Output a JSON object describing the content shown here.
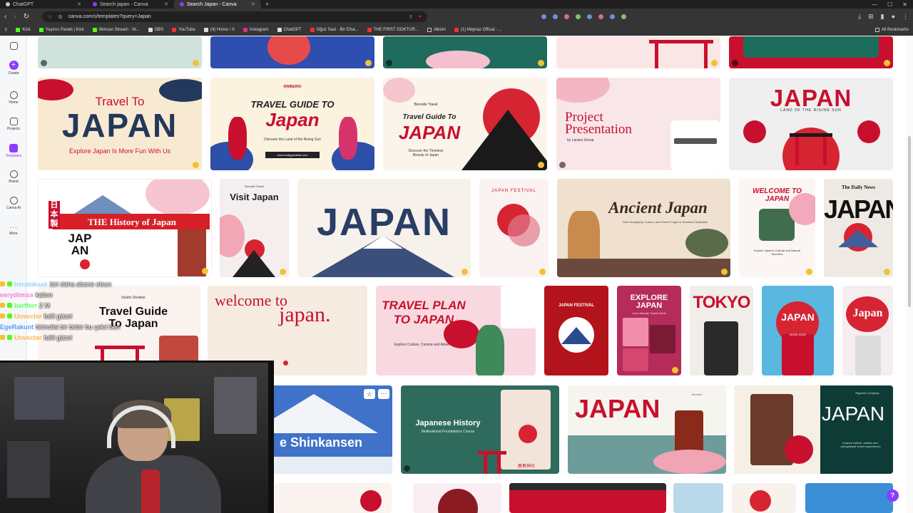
{
  "browser": {
    "tabs": [
      {
        "title": "ChatGPT",
        "active": false
      },
      {
        "title": "Search japan - Canva",
        "active": false
      },
      {
        "title": "Search Japan - Canva",
        "active": true
      }
    ],
    "url": "canva.com/s/templates?query=Japan",
    "bookmarks": [
      "Kick",
      "Yayıncı Paneli | Kick",
      "ilkinsan Stream - W...",
      "OBS",
      "YouTube",
      "(4) Home / X",
      "Instagram",
      "ChatGPT",
      "Oğuz Sasi - Bir Efsa...",
      "THE FIRST GOKTUR...",
      "Albüm",
      "(1) Mepraz Offical - ..."
    ],
    "all_bookmarks": "All Bookmarks"
  },
  "sidebar": {
    "items": [
      {
        "label": "Create",
        "icon": "plus-icon"
      },
      {
        "label": "Home",
        "icon": "home-icon"
      },
      {
        "label": "Projects",
        "icon": "folder-icon"
      },
      {
        "label": "Templates",
        "icon": "templates-icon"
      },
      {
        "label": "Brand",
        "icon": "brand-icon"
      },
      {
        "label": "Canva AI",
        "icon": "canva-ai-icon"
      },
      {
        "label": "More",
        "icon": "more-icon"
      }
    ]
  },
  "templates": {
    "travel_to_japan": {
      "line1": "Travel To",
      "line2": "JAPAN",
      "sub": "Explore Japan Is More Fun With Us"
    },
    "travel_guide_1": {
      "brand": "RIMBERIO",
      "line1": "TRAVEL GUIDE TO",
      "line2": "Japan",
      "sub": "Discover the Land of the Rising Sun",
      "url": "www.reallygreatsite.com"
    },
    "travel_guide_2": {
      "brand": "Borcelle Travel",
      "line1": "Travel Guide To",
      "line2": "JAPAN",
      "sub": "Discover the Timeless Beauty of Japan"
    },
    "project_presentation": {
      "line1": "Project",
      "line2": "Presentation",
      "sub": "by Larana Group"
    },
    "japan_red": {
      "title": "JAPAN",
      "sub": "LAND OF THE RISING SUN"
    },
    "history_of_japan": {
      "title": "THE History of Japan",
      "stamp": "日本製",
      "big": "JAPAN"
    },
    "visit_japan": {
      "brand": "Borcelle Travel",
      "title": "Visit Japan"
    },
    "japan_mountain": {
      "title": "JAPAN"
    },
    "japan_festival_1": {
      "title": "JAPAN FESTIVAL"
    },
    "ancient_japan": {
      "title": "Ancient Japan",
      "sub": "How Geography, Culture, and Power Forged a Timeless Civilization"
    },
    "welcome_to_japan_1": {
      "title": "WELCOME TO JAPAN",
      "sub": "Explore Japan's Cultural and Natural Wonders"
    },
    "daily_news": {
      "masthead": "The Daily News",
      "title": "JAPAN"
    },
    "travel_guide_3": {
      "brand": "Studio Shodwe",
      "line1": "Travel Guide",
      "line2": "To Japan"
    },
    "welcome_to_japan_2": {
      "line1": "welcome to",
      "line2": "japan."
    },
    "travel_plan": {
      "line1": "TRAVEL PLAN",
      "line2": "TO JAPAN",
      "sub": "Explore Culture, Cuisine and Adventure"
    },
    "japan_festival_2": {
      "title": "JAPAN FESTIVAL"
    },
    "explore_japan": {
      "title": "EXPLORE JAPAN",
      "sub": "Your Ultimate Travel Guide"
    },
    "tokyo": {
      "title": "TOKYO"
    },
    "japan_pagoda_blue": {
      "title": "JAPAN",
      "cta": "BOOK NOW"
    },
    "japan_pink": {
      "title": "Japan"
    },
    "shinkansen": {
      "title": "e Shinkansen"
    },
    "japanese_history": {
      "title": "Japanese History",
      "sub": "Multinational Foundations Course",
      "kanji": "鹿島神社"
    },
    "japan_pagoda": {
      "brand": "Borcelle",
      "title": "JAPAN"
    },
    "japan_dark": {
      "brand": "Rigaudo Company",
      "title": "JAPAN",
      "sub": "Explore culture, cuisine and unforgettable travel experiences"
    }
  },
  "chat": [
    {
      "user": "berataksak",
      "user_color": "#8fd8ff",
      "message": "biri daha abone olsun"
    },
    {
      "user": "eerydimiss",
      "user_color": "#ff7ad9",
      "message": "kalsın"
    },
    {
      "user": "berfferr",
      "user_color": "#5cff6a",
      "message": "2 M"
    },
    {
      "user": "Unvecter",
      "user_color": "#ffb347",
      "message": "fuliil güzel"
    },
    {
      "user": "EgeRakunt",
      "user_color": "#4f9dff",
      "message": "birincilsi bir birbir bu çakıl ben"
    },
    {
      "user": "Unvecter",
      "user_color": "#ffb347",
      "message": "fuliil güzel"
    }
  ],
  "help_label": "?",
  "colors": {
    "canva_purple": "#8b3dff",
    "japan_red": "#c8102e",
    "navy": "#23395b"
  }
}
